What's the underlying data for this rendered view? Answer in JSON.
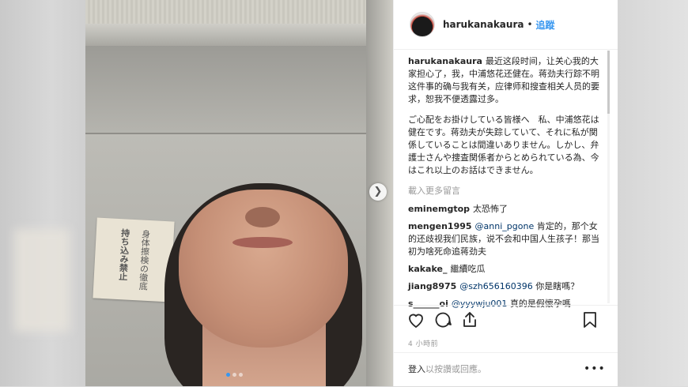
{
  "post": {
    "username": "harukanakaura",
    "follow_label": "追蹤",
    "header_separator": "•",
    "photo_text": {
      "paper_col1": "身体擦検の徹底",
      "paper_col2": "持ち込み禁止"
    },
    "carousel": {
      "slides": 3,
      "active_index": 0
    }
  },
  "caption": {
    "username": "harukanakaura",
    "text_zh": "最近这段时间，让关心我的大家担心了，我，中浦悠花还健在。蒋劲夫行踪不明这件事的确与我有关，应律师和搜查相关人员的要求，恕我不便透露过多。",
    "text_ja": "ご心配をお掛けしている皆様へ　私、中浦悠花は健在です。蒋劲夫が失踪していて、それに私が関係していることは間違いありません。しかし、弁護士さんや捜査関係者からとめられている為、今はこれ以上のお話はできません。"
  },
  "load_more_label": "載入更多留言",
  "comments": [
    {
      "user": "eminemgtop",
      "mention": "",
      "text": "太恐怖了"
    },
    {
      "user": "mengen1995",
      "mention": "@anni_pgone",
      "text": "肯定的，那个女的还歧视我们民族，说不会和中国人生孩子！那当初为啥死命追蒋劲夫"
    },
    {
      "user": "kakake_",
      "mention": "",
      "text": "繼續吃瓜"
    },
    {
      "user": "jiang8975",
      "mention": "@szh656160396",
      "text": "你是瞎嗎？"
    },
    {
      "user": "s______oi",
      "mention": "@yyywju001",
      "text": "真的是假懷孕嗎"
    }
  ],
  "timestamp": "4 小時前",
  "add_comment": {
    "placeholder": "新增留言……",
    "prefix_label": "登入",
    "rest_label": "以按讚或回應。"
  },
  "more_options_label": "•••",
  "icons": {
    "like": "heart-icon",
    "comment": "comment-icon",
    "share": "share-icon",
    "save": "bookmark-icon",
    "next": "chevron-right-icon"
  },
  "colors": {
    "link": "#3897f0",
    "text": "#262626",
    "muted": "#999999"
  }
}
